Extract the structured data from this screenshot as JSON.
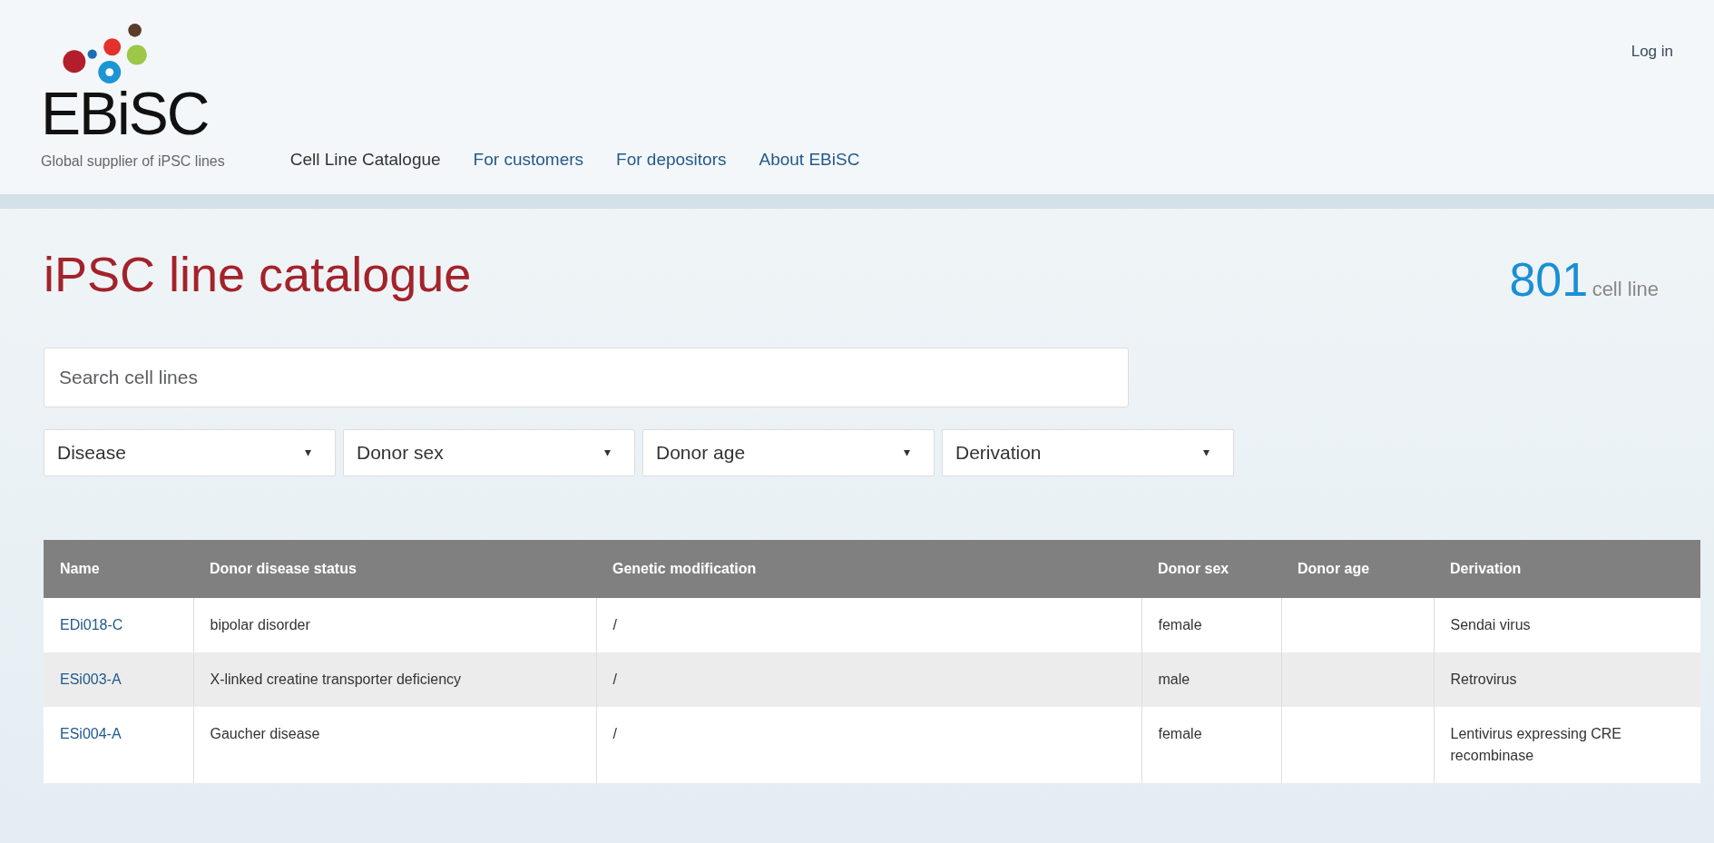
{
  "brand": {
    "name": "EBiSC",
    "tagline": "Global supplier of iPSC lines"
  },
  "nav": [
    {
      "label": "Cell Line Catalogue",
      "selected": true
    },
    {
      "label": "For customers",
      "selected": false
    },
    {
      "label": "For depositors",
      "selected": false
    },
    {
      "label": "About EBiSC",
      "selected": false
    }
  ],
  "login": "Log in",
  "title": "iPSC line catalogue",
  "count": {
    "number": "801",
    "unit": "cell line"
  },
  "search": {
    "placeholder": "Search cell lines"
  },
  "filters": [
    {
      "label": "Disease",
      "caret": "▾"
    },
    {
      "label": "Donor sex",
      "caret": "▾"
    },
    {
      "label": "Donor age",
      "caret": "▾"
    },
    {
      "label": "Derivation",
      "caret": "▾"
    }
  ],
  "table": {
    "columns": [
      "Name",
      "Donor disease status",
      "Genetic modification",
      "Donor sex",
      "Donor age",
      "Derivation"
    ],
    "rows": [
      [
        "EDi018-C",
        "bipolar disorder",
        "/",
        "female",
        "",
        "Sendai virus"
      ],
      [
        "ESi003-A",
        "X-linked creatine transporter deficiency",
        "/",
        "male",
        "",
        "Retrovirus"
      ],
      [
        "ESi004-A",
        "Gaucher disease",
        "/",
        "female",
        "",
        "Lentivirus expressing CRE recombinase"
      ]
    ]
  }
}
